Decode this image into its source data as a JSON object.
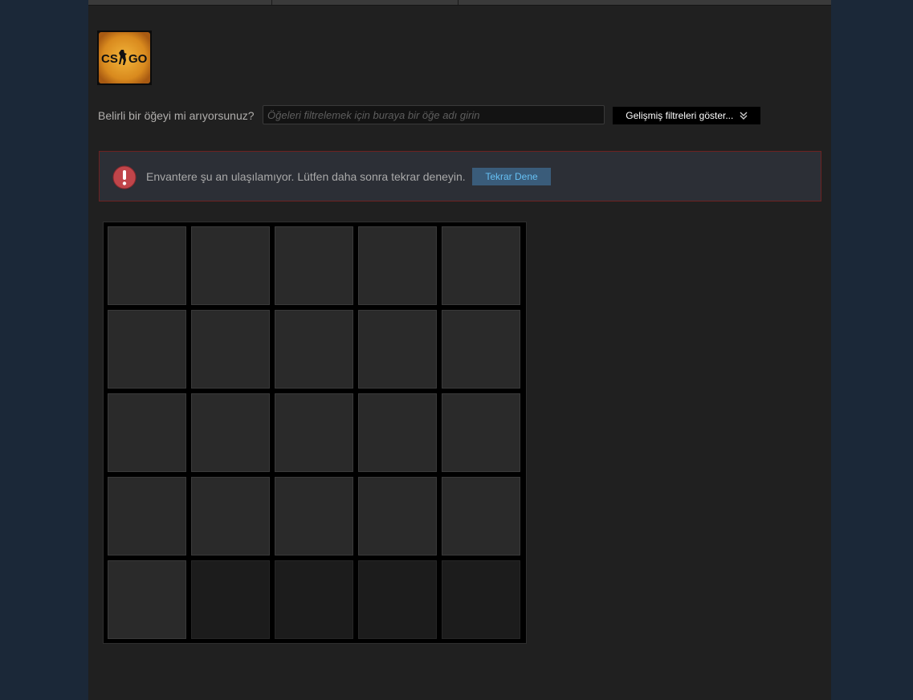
{
  "game": {
    "logo_text": "CS GO",
    "icon": "csgo-logo"
  },
  "filter": {
    "label": "Belirli bir öğeyi mi arıyorsunuz?",
    "placeholder": "Öğeleri filtrelemek için buraya bir öğe adı girin",
    "advanced_button": "Gelişmiş filtreleri göster...",
    "advanced_icon": "double-chevron-down-icon"
  },
  "error": {
    "icon": "exclamation-icon",
    "message": "Envantere şu an ulaşılamıyor. Lütfen daha sonra tekrar deneyin.",
    "retry_label": "Tekrar Dene",
    "border_color": "#6d2120",
    "icon_color": "#c0454a",
    "retry_bg": "#3a5c7a",
    "retry_text_color": "#66c0f4"
  },
  "inventory": {
    "columns": 5,
    "rows": 5,
    "filled_slots": 21,
    "total_slots": 25
  }
}
